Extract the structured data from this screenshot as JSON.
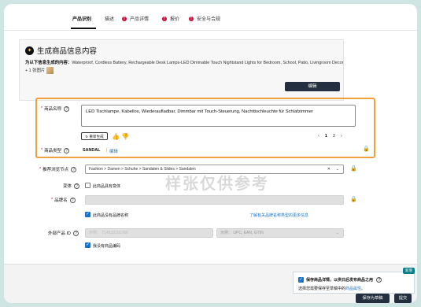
{
  "tabs": {
    "identity": "产品识别",
    "description": "描述",
    "details": "产品详情",
    "offer": "报价",
    "safety": "安全与合规",
    "alert_icon": "!"
  },
  "generate_panel": {
    "title": "生成商品信息内容",
    "desc_label": "为以下信息生成的内容：",
    "desc_text": "Waterproof, Cordless Battery, Rechargeable Desk Lamps-LED Dimmable Touch Nightstand Lights for Bedroom, School, Patio, Livingroom Decor + 1 张图片",
    "edit_button": "编辑"
  },
  "product_name": {
    "label": "商品名称",
    "value": "LED Tischlampe, Kabellos, Wiederaufladbar, Dimmbar mit Touch-Steuerung, Nachttischleuchte für Schlafzimmer",
    "regenerate_button": "重新生成",
    "pager": {
      "prev": "‹",
      "page1": "1",
      "page2": "2",
      "next": "›"
    }
  },
  "product_type": {
    "label": "商品类型",
    "value": "SANDAL",
    "edit_link": "编辑"
  },
  "browse_node": {
    "label": "推荐浏览节点",
    "value": "Fashion > Damen > Schuhe > Sandalen & Slides > Sandalen"
  },
  "variations": {
    "label": "变体",
    "checkbox_label": "此商品具有变体"
  },
  "brand": {
    "label": "品牌名",
    "no_brand_label": "此商品没有品牌名称",
    "learn_more_link": "了解有关品牌名称类型的更多信息"
  },
  "external_id": {
    "label": "外部产品 ID",
    "value_placeholder": "示例： 714532191766",
    "type_placeholder": "示例： UPC, EAN, GTIN",
    "no_id_label": "我没有商品编码"
  },
  "watermark": "样张仅供参考",
  "footer": {
    "save_info_title": "保存商品详情，以供日后发布商品之用",
    "save_info_desc": "选择您需要保存至草稿中的",
    "save_info_link": "商品属性",
    "new_tag": "新增",
    "save_draft_button": "保存为草稿",
    "submit_button": "提交"
  },
  "colors": {
    "highlight": "#f0a13b",
    "primary_button": "#232f3e",
    "link": "#1a73c9",
    "alert": "#cc0c39",
    "background": "#cfe5e3"
  }
}
